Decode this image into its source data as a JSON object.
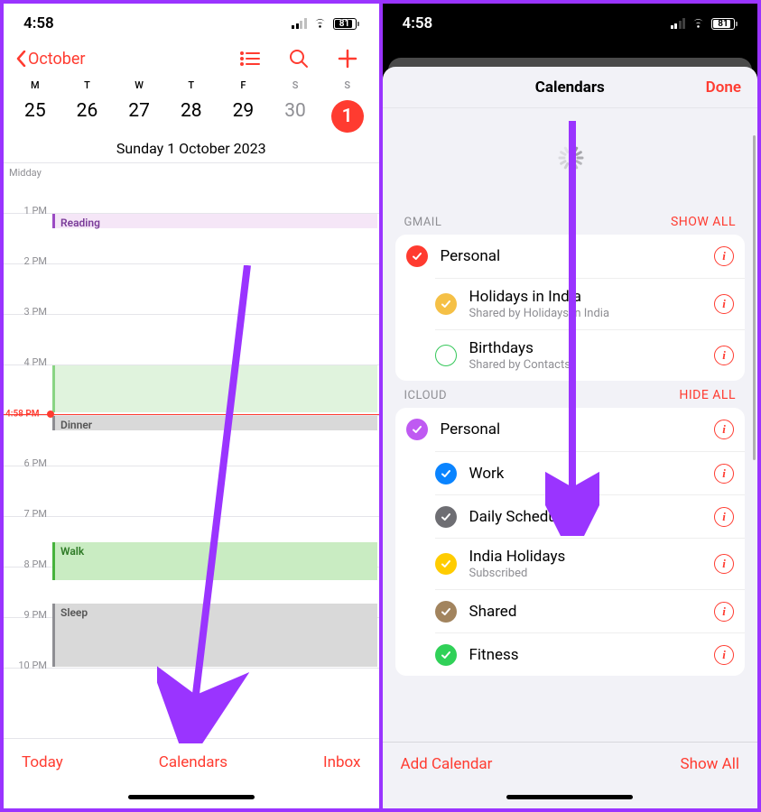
{
  "status": {
    "time": "4:58",
    "battery": "81"
  },
  "left": {
    "back_label": "October",
    "dows": [
      "M",
      "T",
      "W",
      "T",
      "F",
      "S",
      "S"
    ],
    "dates": [
      "25",
      "26",
      "27",
      "28",
      "29",
      "30",
      "1"
    ],
    "date_line": "Sunday  1 October 2023",
    "midday": "Midday",
    "hours": [
      "1 PM",
      "2 PM",
      "3 PM",
      "4 PM",
      "",
      "6 PM",
      "7 PM",
      "8 PM",
      "9 PM",
      "10 PM"
    ],
    "now_label": "4:58 PM",
    "events": {
      "reading": "Reading",
      "dinner": "Dinner",
      "walk": "Walk",
      "sleep": "Sleep"
    },
    "footer": {
      "today": "Today",
      "calendars": "Calendars",
      "inbox": "Inbox"
    }
  },
  "right": {
    "title": "Calendars",
    "done": "Done",
    "groups": [
      {
        "name": "GMAIL",
        "action": "SHOW ALL",
        "items": [
          {
            "name": "Personal",
            "sub": "",
            "color": "#ff3b30",
            "checked": true
          },
          {
            "name": "Holidays in India",
            "sub": "Shared by Holidays in India",
            "color": "#f5c046",
            "checked": true
          },
          {
            "name": "Birthdays",
            "sub": "Shared by Contacts",
            "color": "#34c759",
            "checked": false
          }
        ]
      },
      {
        "name": "ICLOUD",
        "action": "HIDE ALL",
        "items": [
          {
            "name": "Personal",
            "sub": "",
            "color": "#bf5af2",
            "checked": true
          },
          {
            "name": "Work",
            "sub": "",
            "color": "#0a84ff",
            "checked": true
          },
          {
            "name": "Daily Schedule",
            "sub": "",
            "color": "#6e6e73",
            "checked": true
          },
          {
            "name": "India Holidays",
            "sub": "Subscribed",
            "color": "#ffcc00",
            "checked": true
          },
          {
            "name": "Shared",
            "sub": "",
            "color": "#a2845e",
            "checked": true
          },
          {
            "name": "Fitness",
            "sub": "",
            "color": "#30d158",
            "checked": true
          }
        ]
      }
    ],
    "footer": {
      "add": "Add Calendar",
      "show_all": "Show All"
    }
  }
}
